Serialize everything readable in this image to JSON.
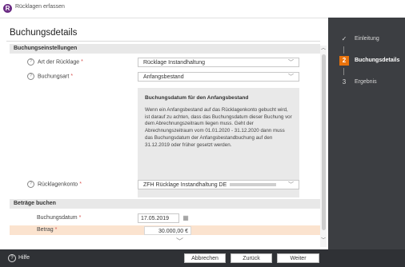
{
  "window": {
    "title": "Rücklagen erfassen",
    "app_icon": "R"
  },
  "page_title": "Buchungsdetails",
  "sections": {
    "settings": "Buchungseinstellungen",
    "amounts": "Beträge buchen"
  },
  "fields": {
    "art": {
      "label": "Art der Rücklage",
      "value": "Rücklage Instandhaltung"
    },
    "buchungsart": {
      "label": "Buchungsart",
      "value": "Anfangsbestand"
    },
    "konto": {
      "label": "Rücklagenkonto",
      "value": "ZFH Rücklage Instandhaltung DE"
    },
    "datum": {
      "label": "Buchungsdatum",
      "value": "17.05.2019"
    },
    "betrag": {
      "label": "Betrag",
      "value": "30.000,00 €"
    }
  },
  "info_box": {
    "title": "Buchungsdatum für den Anfangsbestand",
    "text": "Wenn ein Anfangsbestand auf das Rücklagenkonto gebucht wird, ist darauf zu achten, dass das Buchungsdatum dieser Buchung vor dem Abrechnungszeitraum liegen muss. Geht der Abrechnungszeitraum vom 01.01.2020 - 31.12.2020 dann muss das Buchungsdatum der Anfangsbestandbuchung auf den 31.12.2019 oder früher gesetzt werden."
  },
  "steps": [
    {
      "label": "Einleitung",
      "marker": "✓",
      "state": "done"
    },
    {
      "label": "Buchungsdetails",
      "marker": "2",
      "state": "active"
    },
    {
      "label": "Ergebnis",
      "marker": "3",
      "state": "pending"
    }
  ],
  "footer": {
    "help": "Hilfe",
    "cancel": "Abbrechen",
    "back": "Zurück",
    "next": "Weiter"
  },
  "icons": {
    "help": "question-circle-icon",
    "dropdown": "chevron-down-icon",
    "calendar": "calendar-icon"
  },
  "colors": {
    "accent": "#e8720c",
    "sidebar": "#3c3e42",
    "footer": "#2f3135",
    "highlight_row": "#fbe3cf",
    "required": "#d9534f"
  }
}
